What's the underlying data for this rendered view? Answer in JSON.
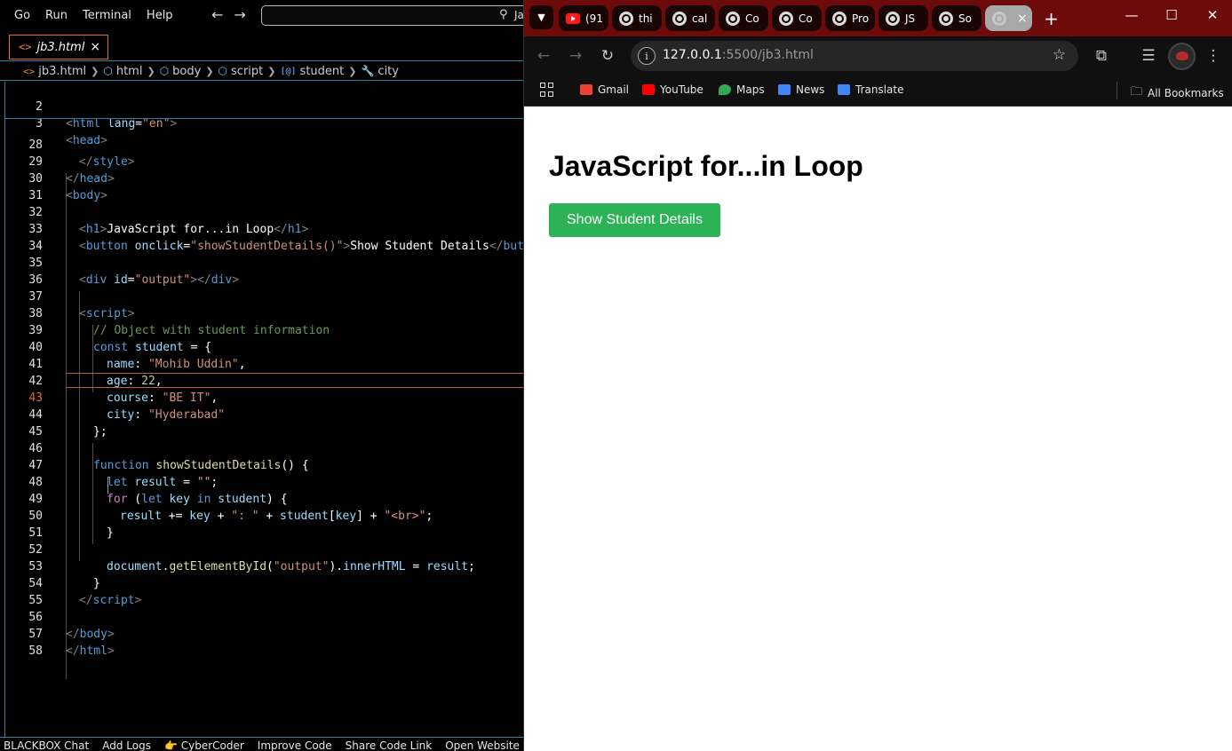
{
  "editor": {
    "menu": [
      "Go",
      "Run",
      "Terminal",
      "Help"
    ],
    "command_center": "Ja",
    "tab": {
      "filename": "jb3.html",
      "close": "×",
      "icon": "<>"
    },
    "breadcrumb": [
      "jb3.html",
      "html",
      "body",
      "script",
      "student",
      "city"
    ],
    "status_items": [
      "BLACKBOX Chat",
      "Add Logs",
      "👉 CyberCoder",
      "Improve Code",
      "Share Code Link",
      "Open Website"
    ]
  },
  "code": {
    "lines": [
      {
        "n": "2"
      },
      {
        "n": "3"
      },
      {
        "n": "28"
      },
      {
        "n": "29"
      },
      {
        "n": "30"
      },
      {
        "n": "31"
      },
      {
        "n": "32"
      },
      {
        "n": "33"
      },
      {
        "n": "34"
      },
      {
        "n": "35"
      },
      {
        "n": "36"
      },
      {
        "n": "37"
      },
      {
        "n": "38"
      },
      {
        "n": "39"
      },
      {
        "n": "40"
      },
      {
        "n": "41"
      },
      {
        "n": "42"
      },
      {
        "n": "43"
      },
      {
        "n": "44"
      },
      {
        "n": "45"
      },
      {
        "n": "46"
      },
      {
        "n": "47"
      },
      {
        "n": "48"
      },
      {
        "n": "49"
      },
      {
        "n": "50"
      },
      {
        "n": "51"
      },
      {
        "n": "52"
      },
      {
        "n": "53"
      },
      {
        "n": "54"
      },
      {
        "n": "55"
      },
      {
        "n": "56"
      },
      {
        "n": "57"
      },
      {
        "n": "58"
      }
    ],
    "tokens": {
      "l2": [
        "<",
        "html",
        " ",
        "lang",
        "=",
        "\"en\"",
        ">"
      ],
      "l3": [
        "<",
        "head",
        ">"
      ],
      "l28": [
        "</",
        "style",
        ">"
      ],
      "l29": [
        "</",
        "head",
        ">"
      ],
      "l30": [
        "<",
        "body",
        ">"
      ],
      "l32": [
        "<",
        "h1",
        ">",
        "JavaScript for...in Loop",
        "</",
        "h1",
        ">"
      ],
      "l33": [
        "<",
        "button",
        " ",
        "onclick",
        "=",
        "\"showStudentDetails()\"",
        ">",
        "Show Student Details",
        "</",
        "butt"
      ],
      "l35": [
        "<",
        "div",
        " ",
        "id",
        "=",
        "\"output\"",
        "></",
        "div",
        ">"
      ],
      "l37": [
        "<",
        "script",
        ">"
      ],
      "l38": [
        "// Object with student information"
      ],
      "l39": [
        "const",
        " ",
        "student",
        " = {"
      ],
      "l40": [
        "name",
        ": ",
        "\"Mohib Uddin\"",
        ","
      ],
      "l41": [
        "age",
        ": ",
        "22",
        ","
      ],
      "l42": [
        "course",
        ": ",
        "\"BE IT\"",
        ","
      ],
      "l43": [
        "city",
        ": ",
        "\"Hyderabad\""
      ],
      "l44": [
        "};"
      ],
      "l46": [
        "function",
        " ",
        "showStudentDetails",
        "() {"
      ],
      "l47": [
        "let",
        " ",
        "result",
        " = ",
        "\"\"",
        ";"
      ],
      "l48": [
        "for",
        " (",
        "let",
        " ",
        "key",
        " ",
        "in",
        " ",
        "student",
        ") {"
      ],
      "l49": [
        "result",
        " += ",
        "key",
        " + ",
        "\": \"",
        " + ",
        "student",
        "[",
        "key",
        "] + ",
        "\"<br>\"",
        ";"
      ],
      "l50": [
        "}"
      ],
      "l52": [
        "document",
        ".",
        "getElementById",
        "(",
        "\"output\"",
        ").",
        "innerHTML",
        " = ",
        "result",
        ";"
      ],
      "l53": [
        "}"
      ],
      "l54": [
        "</",
        "script",
        ">"
      ],
      "l56": [
        "</",
        "body",
        ">"
      ],
      "l57": [
        "</",
        "html",
        ">"
      ]
    }
  },
  "browser": {
    "tabs": [
      {
        "label": "(91",
        "kind": "youtube"
      },
      {
        "label": "thi",
        "kind": "globe"
      },
      {
        "label": "cal",
        "kind": "globe"
      },
      {
        "label": "Co",
        "kind": "globe"
      },
      {
        "label": "Co",
        "kind": "globe"
      },
      {
        "label": "Pro",
        "kind": "globe"
      },
      {
        "label": "JS",
        "kind": "globe"
      },
      {
        "label": "So",
        "kind": "globe"
      },
      {
        "label": "",
        "kind": "globe-active"
      }
    ],
    "active_tab_close": "×",
    "url_host": "127.0.0.1",
    "url_path": ":5500/jb3.html",
    "bookmarks": [
      {
        "label": "Gmail",
        "color": "#ea4335"
      },
      {
        "label": "YouTube",
        "color": "#ff0000"
      },
      {
        "label": "Maps",
        "color": "#34a853"
      },
      {
        "label": "News",
        "color": "#4285f4"
      },
      {
        "label": "Translate",
        "color": "#4285f4"
      }
    ],
    "all_bookmarks": "All Bookmarks"
  },
  "page": {
    "heading": "JavaScript for...in Loop",
    "button_label": "Show Student Details",
    "button_color": "#2bb356"
  }
}
